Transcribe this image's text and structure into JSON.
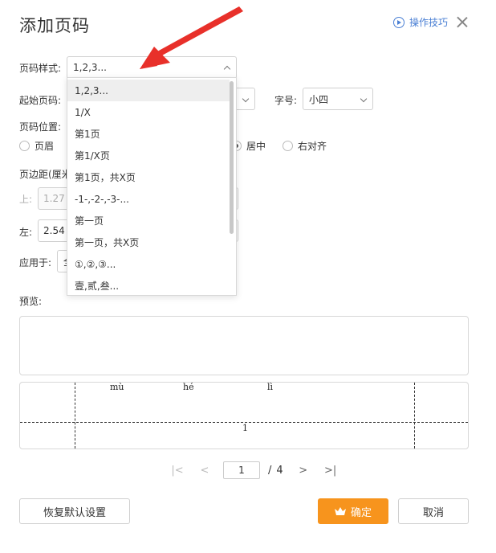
{
  "dialog": {
    "title": "添加页码",
    "help_label": "操作技巧"
  },
  "style": {
    "label": "页码样式:",
    "value": "1,2,3..."
  },
  "dropdown": {
    "items": [
      "1,2,3...",
      "1/X",
      "第1页",
      "第1/X页",
      "第1页，共X页",
      "-1-,-2-,-3-...",
      "第一页",
      "第一页，共X页",
      "①,②,③...",
      "壹,贰,叁..."
    ],
    "selected_index": 0
  },
  "start": {
    "label": "起始页码:"
  },
  "font_size": {
    "label": "字号:",
    "value": "小四"
  },
  "position": {
    "label": "页码位置:",
    "options": [
      "页眉",
      "居中",
      "右对齐"
    ],
    "selected": "居中"
  },
  "margin": {
    "label": "页边距(厘米",
    "top_label": "上:",
    "top_value": "1.27",
    "left_label": "左:",
    "left_value": "2.54"
  },
  "apply": {
    "label": "应用于:",
    "value_fragment": "全"
  },
  "preview": {
    "label": "预览:",
    "pinyin": [
      "mù",
      "hé",
      "lì"
    ],
    "page_number": "1"
  },
  "pager": {
    "current": "1",
    "separator": "/",
    "total": "4"
  },
  "buttons": {
    "reset": "恢复默认设置",
    "ok": "确定",
    "cancel": "取消"
  },
  "colors": {
    "accent": "#f7941d",
    "link": "#4a7fd4",
    "arrow": "#e8302a"
  }
}
